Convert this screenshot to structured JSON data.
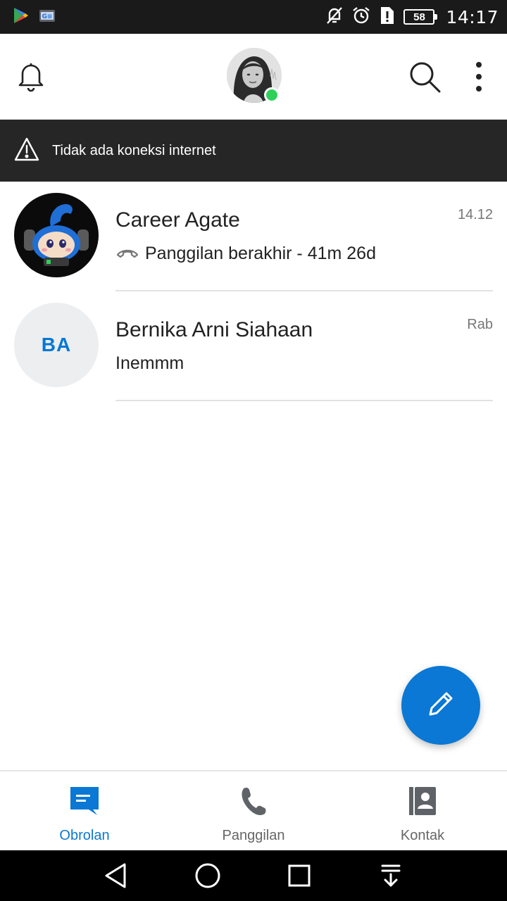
{
  "status_bar": {
    "time": "14:17",
    "battery_level": "58",
    "icons": [
      "play-store-icon",
      "gmail-icon",
      "mute-icon",
      "alarm-icon",
      "sim-alert-icon",
      "battery-icon"
    ]
  },
  "header": {
    "icons": [
      "bell-icon",
      "search-icon",
      "more-vert-icon"
    ],
    "presence_color": "#2fd05a"
  },
  "banner": {
    "text": "Tidak ada koneksi internet",
    "icon": "warning-icon"
  },
  "chats": [
    {
      "name": "Career Agate",
      "time": "14.12",
      "preview": "Panggilan berakhir - 41m 26d",
      "preview_icon": "call-ended-icon"
    },
    {
      "name": "Bernika Arni Siahaan",
      "initials": "BA",
      "time": "Rab",
      "preview": "Inemmm"
    }
  ],
  "fab": {
    "icon": "pencil-icon"
  },
  "bottom_nav": {
    "items": [
      {
        "label": "Obrolan",
        "icon": "chat-icon",
        "active": true
      },
      {
        "label": "Panggilan",
        "icon": "phone-icon",
        "active": false
      },
      {
        "label": "Kontak",
        "icon": "contacts-icon",
        "active": false
      }
    ]
  },
  "colors": {
    "accent": "#0a78d4",
    "banner_bg": "#262626",
    "status_bar_bg": "#1a1a1a"
  }
}
